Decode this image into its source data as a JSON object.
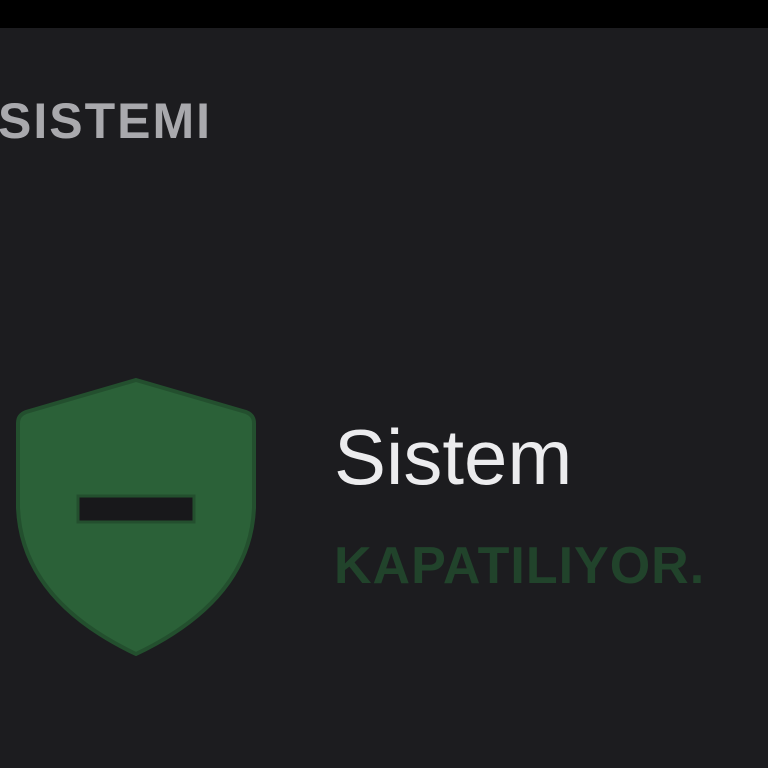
{
  "header": {
    "title": "SISTEMI"
  },
  "status": {
    "title": "Sistem",
    "subtitle": "KAPATILIYOR.",
    "icon": "shield-minus-icon"
  },
  "colors": {
    "background": "#1c1c1f",
    "top_bar": "#000000",
    "header_text": "#a9a9ad",
    "title_text": "#ececee",
    "subtitle_text": "#21432b",
    "shield_fill": "#2b6138",
    "shield_border": "#234f2e",
    "shield_bar": "#18181b"
  }
}
